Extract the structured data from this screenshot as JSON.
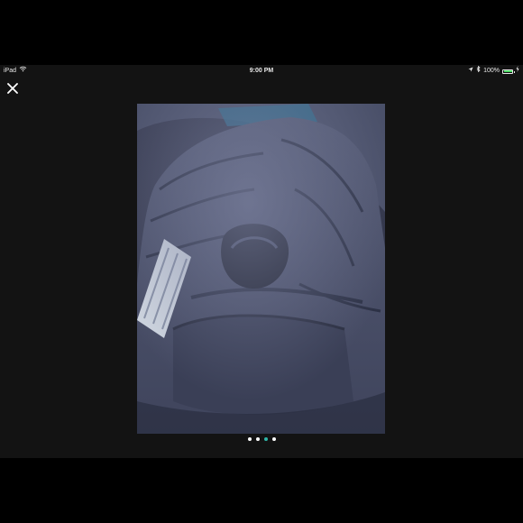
{
  "status_bar": {
    "device": "iPad",
    "time": "9:00 PM",
    "battery": "100%",
    "battery_level": 1.0,
    "icons": [
      "wifi-icon",
      "location-arrow-icon",
      "bluetooth-icon",
      "battery-icon",
      "charging-icon"
    ]
  },
  "viewer": {
    "close_icon": "close-icon",
    "photo_subject": "navy blue puffer jacket photo",
    "pager": {
      "total": 4,
      "active_index": 2
    }
  },
  "colors": {
    "screen_bg": "#131313",
    "pager_active": "#2eb6a8",
    "pager_inactive": "#ffffff",
    "battery_fill": "#4cd964"
  }
}
